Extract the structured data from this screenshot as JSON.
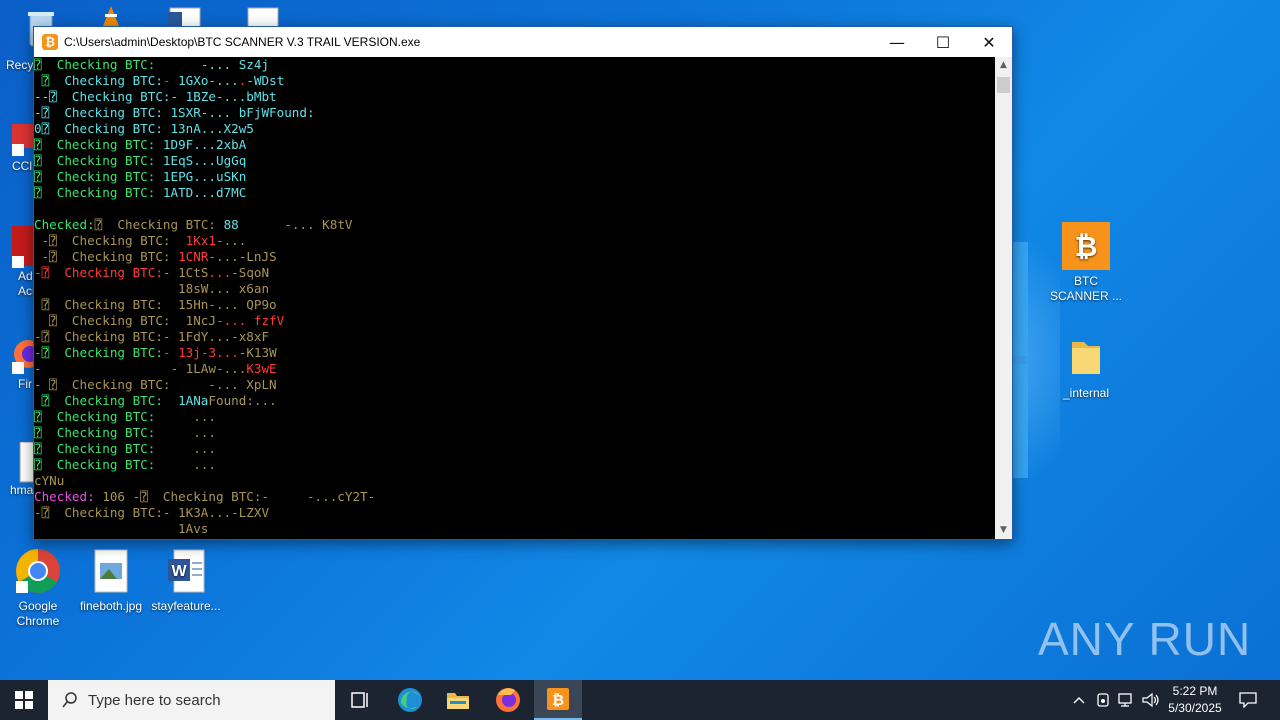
{
  "window": {
    "title": "C:\\Users\\admin\\Desktop\\BTC SCANNER V.3  TRAIL VERSION.exe",
    "minimize": "—",
    "maximize": "☐",
    "close": "✕"
  },
  "desktop": {
    "left_icons": [
      {
        "name": "recycle-bin",
        "label": "Recy"
      },
      {
        "name": "ccleaner",
        "label": "CCl"
      },
      {
        "name": "adobe-acrobat",
        "label": "Ad\nAcr"
      },
      {
        "name": "firefox",
        "label": "Fir"
      },
      {
        "name": "hma",
        "label": "hma"
      }
    ],
    "bottom_icons": [
      {
        "name": "google-chrome",
        "label": "Google\nChrome"
      },
      {
        "name": "fineboth-jpg",
        "label": "fineboth.jpg"
      },
      {
        "name": "stayfeature",
        "label": "stayfeature..."
      }
    ],
    "right_icons": [
      {
        "name": "btc-scanner",
        "label": "BTC\nSCANNER ..."
      },
      {
        "name": "internal-folder",
        "label": "_internal"
      }
    ]
  },
  "console_lines": [
    [
      [
        "g",
        "⍰  Checking BTC:      "
      ],
      [
        "c",
        "-... Sz4j"
      ]
    ],
    [
      [
        "g",
        " ⍰  "
      ],
      [
        "c",
        "Checking BTC:"
      ],
      [
        "r",
        "- "
      ],
      [
        "c",
        "1GXo-..."
      ],
      [
        "r",
        "."
      ],
      [
        "c",
        "-WDst"
      ]
    ],
    [
      [
        "c",
        "--⍰  Checking BTC:- 1BZe-...bMbt"
      ]
    ],
    [
      [
        "c",
        "-⍰  Checking BTC: 1SXR-... bFjWFound:"
      ]
    ],
    [
      [
        "c",
        "0⍰  Checking BTC: 13nA...X2w5"
      ]
    ],
    [
      [
        "g",
        "⍰  Checking BTC: "
      ],
      [
        "c",
        "1D9F...2xbA"
      ]
    ],
    [
      [
        "g",
        "⍰  Checking BTC: "
      ],
      [
        "c",
        "1EqS...UgGq"
      ]
    ],
    [
      [
        "g",
        "⍰  Checking BTC: "
      ],
      [
        "c",
        "1EPG...uSKn"
      ]
    ],
    [
      [
        "g",
        "⍰  Checking BTC: "
      ],
      [
        "c",
        "1ATD...d7MC"
      ]
    ],
    [
      [
        "w",
        ""
      ]
    ],
    [
      [
        "g",
        "Checked:"
      ],
      [
        "o",
        "⍰  Checking BTC: "
      ],
      [
        "c",
        "88      "
      ],
      [
        "o",
        "-... K8tV"
      ]
    ],
    [
      [
        "o",
        " -⍰  Checking BTC:  "
      ],
      [
        "r",
        "1Kx1"
      ],
      [
        "o",
        "-..."
      ]
    ],
    [
      [
        "o",
        " -⍰  Checking BTC: "
      ],
      [
        "r",
        "1CNR"
      ],
      [
        "o",
        "-...-LnJS"
      ]
    ],
    [
      [
        "r",
        "-⍰  Checking BTC:"
      ],
      [
        "o",
        "- 1CtS"
      ],
      [
        "r",
        "..."
      ],
      [
        "o",
        "-SqoN"
      ]
    ],
    [
      [
        "o",
        "                   18sW... x6an"
      ]
    ],
    [
      [
        "o",
        " ⍰  Checking BTC:  15Hn-... QP9o"
      ]
    ],
    [
      [
        "o",
        "  ⍰  Checking BTC:  1NcJ"
      ],
      [
        "r",
        "-... fzfV"
      ]
    ],
    [
      [
        "o",
        "-⍰  Checking BTC:- 1FdY...-x8xF"
      ]
    ],
    [
      [
        "o",
        "-"
      ],
      [
        "g",
        "⍰  Checking BTC:"
      ],
      [
        "r",
        "- 13j-3..."
      ],
      [
        "o",
        "-K13W"
      ]
    ],
    [
      [
        "o",
        "-                 - 1LAw-..."
      ],
      [
        "r",
        "K3wE"
      ]
    ],
    [
      [
        "o",
        "- ⍰  Checking BTC:     -... XpLN"
      ]
    ],
    [
      [
        "g",
        " ⍰  Checking BTC:  "
      ],
      [
        "c",
        "1ANa"
      ],
      [
        "o",
        "Found:..."
      ]
    ],
    [
      [
        "g",
        "⍰  Checking BTC:     "
      ],
      [
        "o",
        "..."
      ]
    ],
    [
      [
        "g",
        "⍰  Checking BTC:     "
      ],
      [
        "o",
        "..."
      ]
    ],
    [
      [
        "g",
        "⍰  Checking BTC:     "
      ],
      [
        "o",
        "..."
      ]
    ],
    [
      [
        "g",
        "⍰  Checking BTC:     "
      ],
      [
        "o",
        "..."
      ]
    ],
    [
      [
        "o",
        "cYNu"
      ]
    ],
    [
      [
        "m",
        "Checked: "
      ],
      [
        "o",
        "106 -⍰  Checking BTC:-     -...cY2T-"
      ]
    ],
    [
      [
        "o",
        "-⍰  Checking BTC:- 1K3A...-LZXV"
      ]
    ],
    [
      [
        "o",
        "                   1Avs"
      ]
    ]
  ],
  "colors": {
    "g": "#39e46a",
    "c": "#5fe3e8",
    "r": "#ff3b3b",
    "o": "#a89554",
    "m": "#e64ee6",
    "w": "#cfcfcf"
  },
  "watermark": "ANY RUN",
  "taskbar": {
    "search_placeholder": "Type here to search",
    "apps": [
      "task-view",
      "edge",
      "file-explorer",
      "firefox",
      "btc-scanner"
    ],
    "time": "5:22 PM",
    "date": "5/30/2025"
  }
}
